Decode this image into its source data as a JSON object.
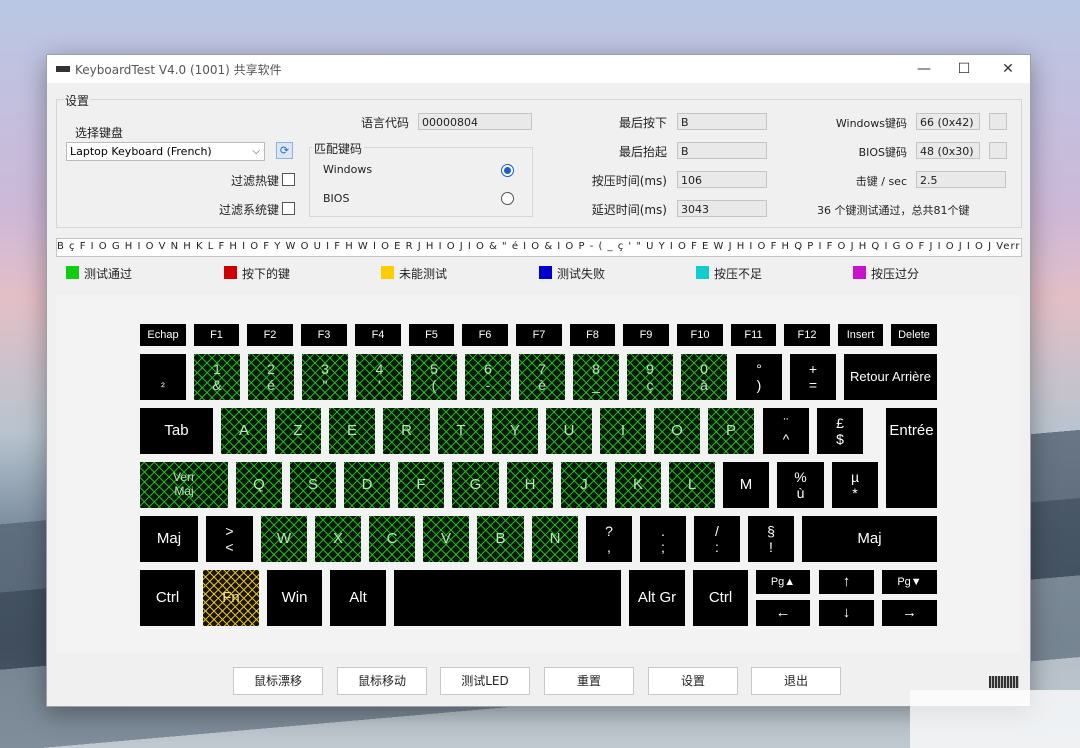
{
  "window": {
    "title": "KeyboardTest V4.0 (1001) 共享软件",
    "minimize": "—",
    "maximize": "☐",
    "close": "✕"
  },
  "settings": {
    "group_title": "设置",
    "select_keyboard_label": "选择键盘",
    "keyboard_value": "Laptop Keyboard (French)",
    "lang_code_label": "语言代码",
    "lang_code_value": "00000804",
    "filter_hotkeys": "过滤热键",
    "filter_system_keys": "过滤系统键",
    "match_code_title": "匹配键码",
    "radio_windows": "Windows",
    "radio_bios": "BIOS",
    "last_pressed_label": "最后按下",
    "last_pressed_value": "B",
    "last_released_label": "最后抬起",
    "last_released_value": "B",
    "press_time_label": "按压时间(ms)",
    "press_time_value": "106",
    "latency_label": "延迟时间(ms)",
    "latency_value": "3043",
    "windows_code_label": "Windows键码",
    "windows_code_value": "66 (0x42)",
    "bios_code_label": "BIOS键码",
    "bios_code_value": "48 (0x30)",
    "keys_per_sec_label": "击键 / sec",
    "keys_per_sec_value": "2.5",
    "summary": "36 个键测试通过，总共81个键"
  },
  "history": "B ç F I O G H I O V N H K L F H I O F Y W O U I F H W I O E R J H I O J I O & \" é I O & I O P - ( _ ç ' \" U Y I O F E W J H I O F H Q P I F O J H Q I G O F J I O J I O J VerrMaj H I O H F I O A H I F O U I O F R E J I D",
  "legend": [
    {
      "label": "测试通过",
      "color": "#11cc11"
    },
    {
      "label": "按下的键",
      "color": "#cc0000"
    },
    {
      "label": "未能测试",
      "color": "#ffcc00"
    },
    {
      "label": "测试失败",
      "color": "#0000cc"
    },
    {
      "label": "按压不足",
      "color": "#11cccc"
    },
    {
      "label": "按压过分",
      "color": "#cc11cc"
    }
  ],
  "keys": {
    "esc": "Echap",
    "f1": "F1",
    "f2": "F2",
    "f3": "F3",
    "f4": "F4",
    "f5": "F5",
    "f6": "F6",
    "f7": "F7",
    "f8": "F8",
    "f9": "F9",
    "f10": "F10",
    "f11": "F11",
    "f12": "F12",
    "insert": "Insert",
    "delete": "Delete",
    "sq2": "²",
    "k1_top": "1",
    "k1_bot": "&",
    "k2_top": "2",
    "k2_bot": "é",
    "k3_top": "3",
    "k3_bot": "\"",
    "k4_top": "4",
    "k4_bot": "'",
    "k5_top": "5",
    "k5_bot": "(",
    "k6_top": "6",
    "k6_bot": "-",
    "k7_top": "7",
    "k7_bot": "è",
    "k8_top": "8",
    "k8_bot": "_",
    "k9_top": "9",
    "k9_bot": "ç",
    "k0_top": "0",
    "k0_bot": "à",
    "deg_top": "°",
    "deg_bot": ")",
    "plus_top": "+",
    "plus_bot": "=",
    "backspace": "Retour Arrière",
    "tab": "Tab",
    "a": "A",
    "z": "Z",
    "e": "E",
    "r": "R",
    "t": "T",
    "y": "Y",
    "u": "U",
    "i": "I",
    "o": "O",
    "p": "P",
    "trema_top": "¨",
    "trema_bot": "^",
    "pound_top": "£",
    "pound_bot": "$",
    "enter": "Entrée",
    "caps_top": "Verr",
    "caps_bot": "Maj",
    "q": "Q",
    "s": "S",
    "d": "D",
    "f": "F",
    "g": "G",
    "h": "H",
    "j": "J",
    "k": "K",
    "l": "L",
    "m": "M",
    "pct_top": "%",
    "pct_bot": "ù",
    "mu_top": "µ",
    "mu_bot": "*",
    "lshift": "Maj",
    "gt_top": ">",
    "gt_bot": "<",
    "w": "W",
    "x": "X",
    "c": "C",
    "v": "V",
    "b": "B",
    "n": "N",
    "q_top": "?",
    "q_bot": ",",
    "dot_top": ".",
    "dot_bot": ";",
    "slash_top": "/",
    "slash_bot": ":",
    "sect_top": "§",
    "sect_bot": "!",
    "rshift": "Maj",
    "lctrl": "Ctrl",
    "fn": "Fn",
    "win": "Win",
    "alt": "Alt",
    "altgr": "Alt Gr",
    "rctrl": "Ctrl",
    "pgup": "Pg▲",
    "up": "↑",
    "pgdn": "Pg▼",
    "left": "←",
    "down": "↓",
    "right": "→"
  },
  "buttons": {
    "mouse_drift": "鼠标漂移",
    "mouse_move": "鼠标移动",
    "test_led": "测试LED",
    "reset": "重置",
    "settings": "设置",
    "exit": "退出"
  }
}
